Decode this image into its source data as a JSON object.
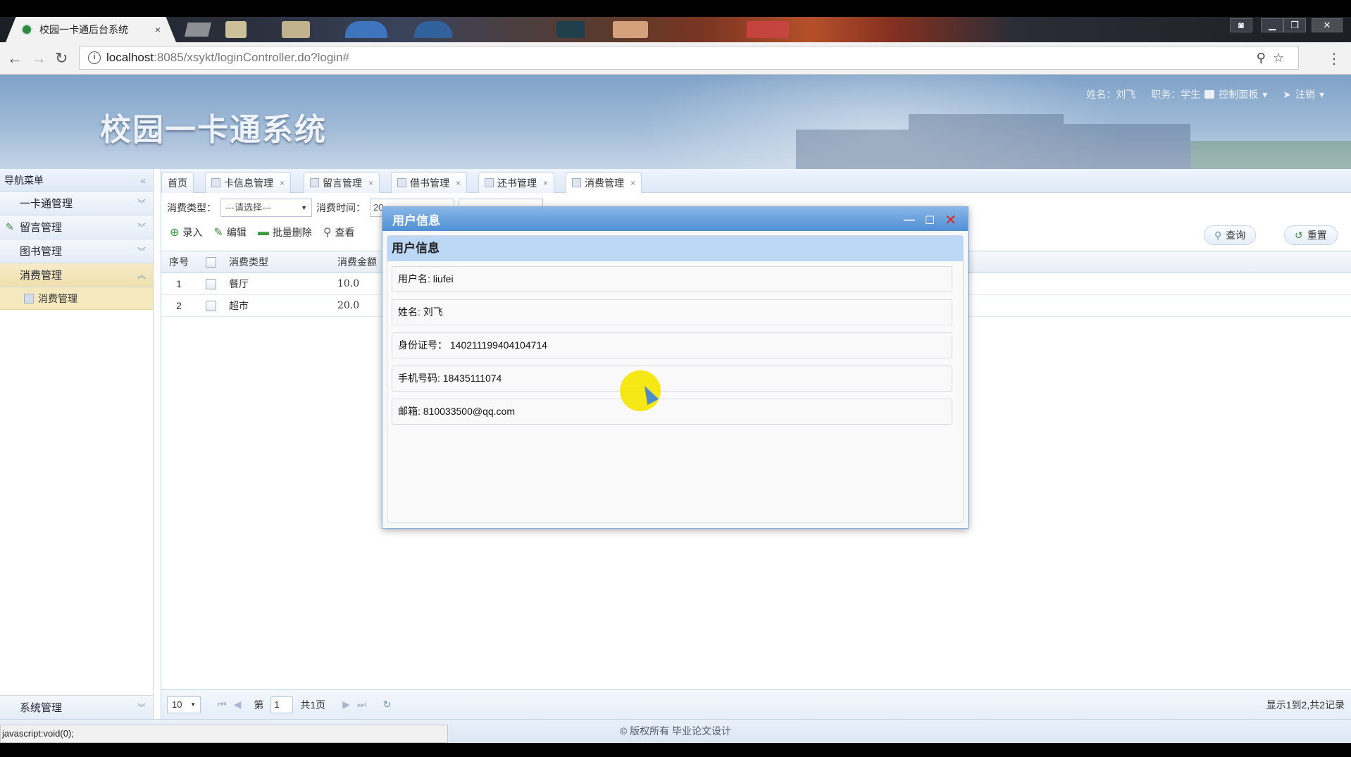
{
  "browser": {
    "tab_title": "校园一卡通后台系统",
    "tab_close": "×",
    "url_host": "localhost",
    "url_rest": ":8085/xsykt/loginController.do?login#",
    "status_url": "javascript:void(0);"
  },
  "header": {
    "system_title": "校园一卡通系统",
    "user_label": "姓名：刘飞",
    "role_label": "职务：学生",
    "control_panel": "控制面板",
    "logout": "注销"
  },
  "sidebar": {
    "title": "导航菜单",
    "items": [
      {
        "label": "一卡通管理"
      },
      {
        "label": "留言管理"
      },
      {
        "label": "图书管理"
      },
      {
        "label": "消费管理"
      }
    ],
    "sub_item": "消费管理",
    "bottom_item": "系统管理"
  },
  "tabs": [
    {
      "label": "首页"
    },
    {
      "label": "卡信息管理"
    },
    {
      "label": "留言管理"
    },
    {
      "label": "借书管理"
    },
    {
      "label": "还书管理"
    },
    {
      "label": "消费管理"
    }
  ],
  "filter": {
    "type_label": "消费类型：",
    "type_value": "---请选择---",
    "time_label": "消费时间：",
    "time_value": "20"
  },
  "toolbar": {
    "add": "录入",
    "edit": "编辑",
    "batch_delete": "批量删除",
    "view": "查看",
    "query": "查询",
    "reset": "重置"
  },
  "grid": {
    "headers": {
      "no": "序号",
      "type": "消费类型",
      "amount": "消费金额"
    },
    "rows": [
      {
        "no": "1",
        "type": "餐厅",
        "amount": "10.0"
      },
      {
        "no": "2",
        "type": "超市",
        "amount": "20.0"
      }
    ]
  },
  "pager": {
    "page_size": "10",
    "page_prefix": "第",
    "page_num": "1",
    "page_total": "共1页",
    "summary": "显示1到2,共2记录"
  },
  "footer": "© 版权所有 毕业论文设计",
  "dialog": {
    "title": "用户信息",
    "panel_title": "用户信息",
    "fields": [
      "用户名: liufei",
      "姓名: 刘飞",
      "身份证号： 140211199404104714",
      "手机号码: 18435111074",
      "邮箱: 810033500@qq.com"
    ]
  },
  "icons": {
    "colors": {
      "accent": "#4f8fd4",
      "active_menu": "#eedfac",
      "close": "#e0241b"
    }
  }
}
